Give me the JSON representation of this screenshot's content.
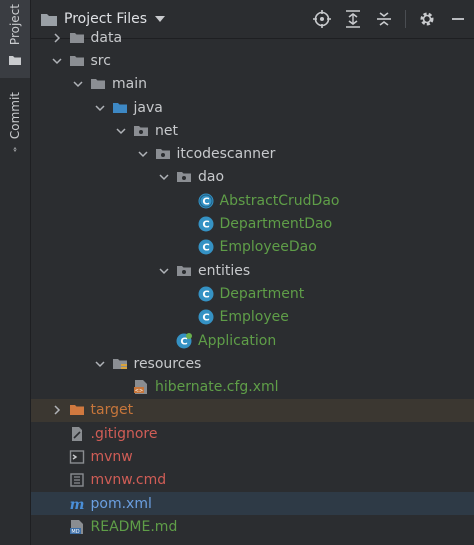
{
  "side_tabs": {
    "project": "Project",
    "commit": "Commit"
  },
  "header": {
    "title": "Project Files"
  },
  "toolbar": {
    "icons": [
      "locate-icon",
      "expand-all-icon",
      "collapse-all-icon",
      "settings-icon",
      "hide-icon"
    ]
  },
  "tree": [
    {
      "label": "data",
      "depth": 1,
      "arrow": "right",
      "icon": "folder",
      "color": "default"
    },
    {
      "label": "src",
      "depth": 1,
      "arrow": "down",
      "icon": "folder",
      "color": "default"
    },
    {
      "label": "main",
      "depth": 2,
      "arrow": "down",
      "icon": "folder",
      "color": "default"
    },
    {
      "label": "java",
      "depth": 3,
      "arrow": "down",
      "icon": "source-folder",
      "color": "default"
    },
    {
      "label": "net",
      "depth": 4,
      "arrow": "down",
      "icon": "package",
      "color": "default"
    },
    {
      "label": "itcodescanner",
      "depth": 5,
      "arrow": "down",
      "icon": "package",
      "color": "default"
    },
    {
      "label": "dao",
      "depth": 6,
      "arrow": "down",
      "icon": "package",
      "color": "default"
    },
    {
      "label": "AbstractCrudDao",
      "depth": 7,
      "arrow": "none",
      "icon": "abstract-class",
      "color": "green"
    },
    {
      "label": "DepartmentDao",
      "depth": 7,
      "arrow": "none",
      "icon": "class",
      "color": "green"
    },
    {
      "label": "EmployeeDao",
      "depth": 7,
      "arrow": "none",
      "icon": "class",
      "color": "green"
    },
    {
      "label": "entities",
      "depth": 6,
      "arrow": "down",
      "icon": "package",
      "color": "default"
    },
    {
      "label": "Department",
      "depth": 7,
      "arrow": "none",
      "icon": "class",
      "color": "green"
    },
    {
      "label": "Employee",
      "depth": 7,
      "arrow": "none",
      "icon": "class",
      "color": "green"
    },
    {
      "label": "Application",
      "depth": 6,
      "arrow": "none",
      "icon": "spring-class",
      "color": "green"
    },
    {
      "label": "resources",
      "depth": 3,
      "arrow": "down",
      "icon": "resources-folder",
      "color": "default"
    },
    {
      "label": "hibernate.cfg.xml",
      "depth": 4,
      "arrow": "none",
      "icon": "xml-file",
      "color": "green"
    },
    {
      "label": "target",
      "depth": 1,
      "arrow": "right",
      "icon": "excluded-folder",
      "color": "orange",
      "highlight": true
    },
    {
      "label": ".gitignore",
      "depth": 1,
      "arrow": "none",
      "icon": "gitignore-file",
      "color": "red"
    },
    {
      "label": "mvnw",
      "depth": 1,
      "arrow": "none",
      "icon": "shell-file",
      "color": "red"
    },
    {
      "label": "mvnw.cmd",
      "depth": 1,
      "arrow": "none",
      "icon": "text-file",
      "color": "red"
    },
    {
      "label": "pom.xml",
      "depth": 1,
      "arrow": "none",
      "icon": "maven-file",
      "color": "blue",
      "selected": true
    },
    {
      "label": "README.md",
      "depth": 1,
      "arrow": "none",
      "icon": "markdown-file",
      "color": "green"
    }
  ],
  "colors": {
    "default": "#c7c9cc",
    "green": "#5f9e48",
    "orange": "#c7763b",
    "red": "#d05d56",
    "blue": "#6b9fe0",
    "class_icon": "#3592c4",
    "folder": "#8b8e93",
    "source_folder": "#3d88c4"
  }
}
